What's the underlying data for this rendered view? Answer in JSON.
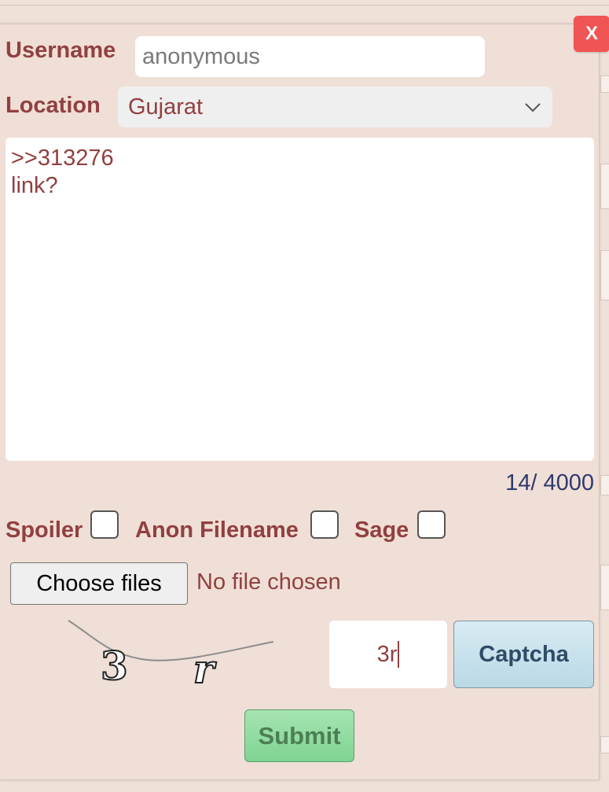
{
  "form": {
    "close_label": "X",
    "username": {
      "label": "Username",
      "value": "anonymous"
    },
    "location": {
      "label": "Location",
      "selected": "Gujarat"
    },
    "message": {
      "text": ">>313276\nlink?",
      "char_count": "14/ 4000"
    },
    "options": {
      "spoiler_label": "Spoiler",
      "anon_filename_label": "Anon Filename",
      "sage_label": "Sage"
    },
    "files": {
      "button_label": "Choose files",
      "status": "No file chosen"
    },
    "captcha": {
      "image_text": "3 r",
      "input_value": "3r",
      "button_label": "Captcha"
    },
    "submit_label": "Submit"
  },
  "colors": {
    "background": "#efe0d8",
    "label": "#914040",
    "close": "#f05454",
    "submit": "#7fd492",
    "captcha_button": "#b9d9e6",
    "counter": "#2e3a70"
  },
  "icons": {
    "select": "chevron-down-icon"
  }
}
